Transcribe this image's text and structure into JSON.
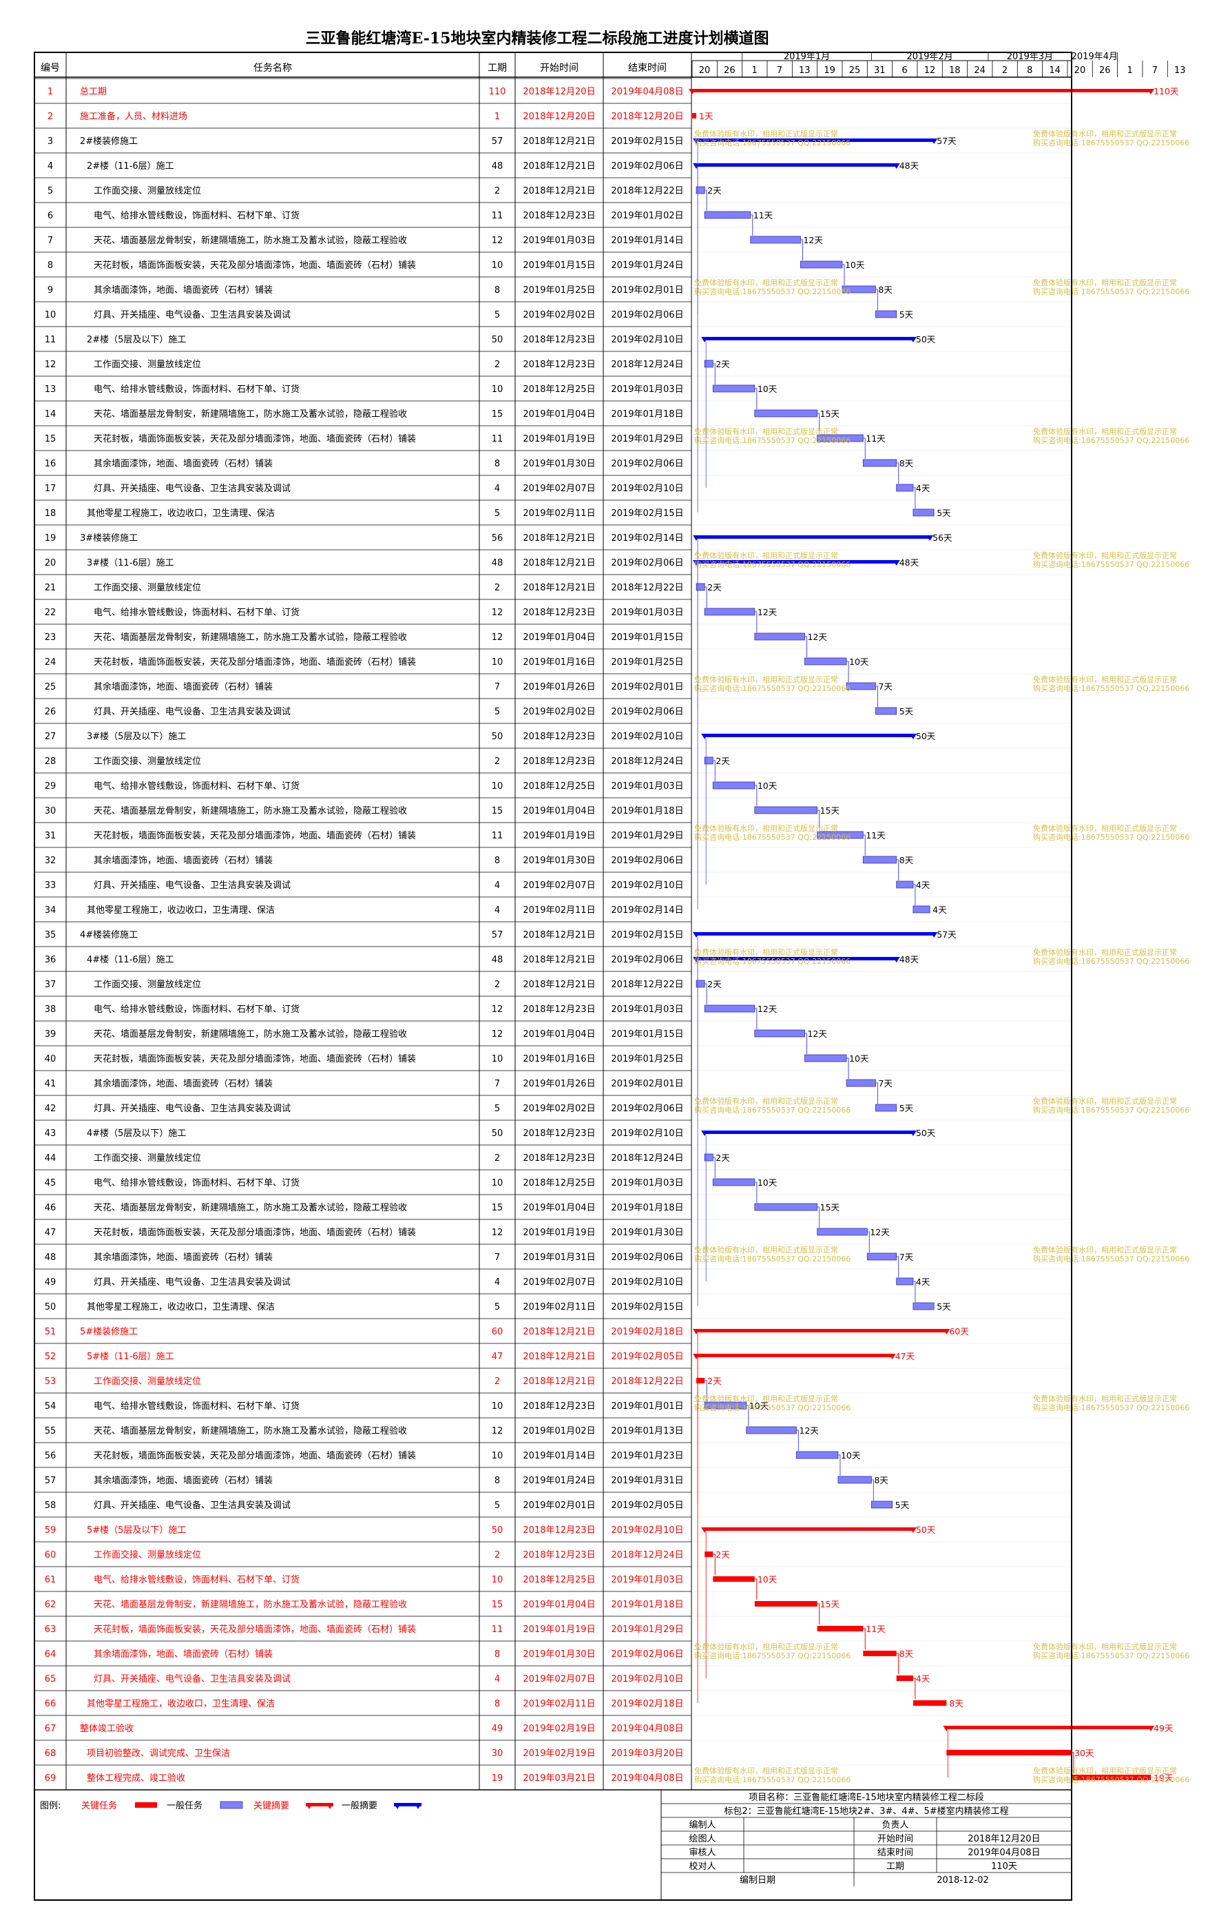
{
  "title": "三亚鲁能红塘湾E-15地块室内精装修工程二标段施工进度计划横道图",
  "table_headers": {
    "id": "编号",
    "name": "任务名称",
    "duration": "工期",
    "start": "开始时间",
    "end": "结束时间"
  },
  "timeline": {
    "months": [
      "2019年1月",
      "2019年2月",
      "2019年3月",
      "2019年4月"
    ],
    "ticks": [
      "20",
      "26",
      "1",
      "7",
      "13",
      "19",
      "25",
      "31",
      "6",
      "12",
      "18",
      "24",
      "2",
      "8",
      "14",
      "20",
      "26",
      "1",
      "7",
      "13"
    ]
  },
  "chart_data": {
    "type": "gantt",
    "x_range": [
      "2018-12-20",
      "2019-04-16"
    ],
    "tasks": [
      {
        "id": "1",
        "name": "总工期",
        "duration": "110",
        "start": "2018年12月20日",
        "end": "2019年04月08日",
        "kind": "key-summary",
        "critical": true,
        "level": 0,
        "label": "110天"
      },
      {
        "id": "2",
        "name": "施工准备，人员、材料进场",
        "duration": "1",
        "start": "2018年12月20日",
        "end": "2018年12月20日",
        "kind": "key-task",
        "critical": true,
        "level": 0,
        "label": "1天"
      },
      {
        "id": "3",
        "name": "2#楼装修施工",
        "duration": "57",
        "start": "2018年12月21日",
        "end": "2019年02月15日",
        "kind": "summary",
        "critical": false,
        "level": 0,
        "label": "57天"
      },
      {
        "id": "4",
        "name": "2#楼（11-6层）施工",
        "duration": "48",
        "start": "2018年12月21日",
        "end": "2019年02月06日",
        "kind": "summary",
        "critical": false,
        "level": 1,
        "label": "48天"
      },
      {
        "id": "5",
        "name": "工作面交接、测量放线定位",
        "duration": "2",
        "start": "2018年12月21日",
        "end": "2018年12月22日",
        "kind": "task",
        "critical": false,
        "level": 2,
        "label": "2天"
      },
      {
        "id": "6",
        "name": "电气、给排水管线敷设，饰面材料、石材下单、订货",
        "duration": "11",
        "start": "2018年12月23日",
        "end": "2019年01月02日",
        "kind": "task",
        "critical": false,
        "level": 2,
        "label": "11天"
      },
      {
        "id": "7",
        "name": "天花、墙面基层龙骨制安，新建隔墙施工，防水施工及蓄水试验，隐蔽工程验收",
        "duration": "12",
        "start": "2019年01月03日",
        "end": "2019年01月14日",
        "kind": "task",
        "critical": false,
        "level": 2,
        "label": "12天"
      },
      {
        "id": "8",
        "name": "天花封板，墙面饰面板安装，天花及部分墙面漆饰，地面、墙面瓷砖（石材）铺装",
        "duration": "10",
        "start": "2019年01月15日",
        "end": "2019年01月24日",
        "kind": "task",
        "critical": false,
        "level": 2,
        "label": "10天"
      },
      {
        "id": "9",
        "name": "其余墙面漆饰，地面、墙面瓷砖（石材）铺装",
        "duration": "8",
        "start": "2019年01月25日",
        "end": "2019年02月01日",
        "kind": "task",
        "critical": false,
        "level": 2,
        "label": "8天"
      },
      {
        "id": "10",
        "name": "灯具、开关插座、电气设备、卫生洁具安装及调试",
        "duration": "5",
        "start": "2019年02月02日",
        "end": "2019年02月06日",
        "kind": "task",
        "critical": false,
        "level": 2,
        "label": "5天"
      },
      {
        "id": "11",
        "name": "2#楼（5层及以下）施工",
        "duration": "50",
        "start": "2018年12月23日",
        "end": "2019年02月10日",
        "kind": "summary",
        "critical": false,
        "level": 1,
        "label": "50天"
      },
      {
        "id": "12",
        "name": "工作面交接、测量放线定位",
        "duration": "2",
        "start": "2018年12月23日",
        "end": "2018年12月24日",
        "kind": "task",
        "critical": false,
        "level": 2,
        "label": "2天"
      },
      {
        "id": "13",
        "name": "电气、给排水管线敷设，饰面材料、石材下单、订货",
        "duration": "10",
        "start": "2018年12月25日",
        "end": "2019年01月03日",
        "kind": "task",
        "critical": false,
        "level": 2,
        "label": "10天"
      },
      {
        "id": "14",
        "name": "天花、墙面基层龙骨制安，新建隔墙施工，防水施工及蓄水试验，隐蔽工程验收",
        "duration": "15",
        "start": "2019年01月04日",
        "end": "2019年01月18日",
        "kind": "task",
        "critical": false,
        "level": 2,
        "label": "15天"
      },
      {
        "id": "15",
        "name": "天花封板，墙面饰面板安装，天花及部分墙面漆饰，地面、墙面瓷砖（石材）铺装",
        "duration": "11",
        "start": "2019年01月19日",
        "end": "2019年01月29日",
        "kind": "task",
        "critical": false,
        "level": 2,
        "label": "11天"
      },
      {
        "id": "16",
        "name": "其余墙面漆饰，地面、墙面瓷砖（石材）铺装",
        "duration": "8",
        "start": "2019年01月30日",
        "end": "2019年02月06日",
        "kind": "task",
        "critical": false,
        "level": 2,
        "label": "8天"
      },
      {
        "id": "17",
        "name": "灯具、开关插座、电气设备、卫生洁具安装及调试",
        "duration": "4",
        "start": "2019年02月07日",
        "end": "2019年02月10日",
        "kind": "task",
        "critical": false,
        "level": 2,
        "label": "4天"
      },
      {
        "id": "18",
        "name": "其他零星工程施工，收边收口，卫生清理、保洁",
        "duration": "5",
        "start": "2019年02月11日",
        "end": "2019年02月15日",
        "kind": "task",
        "critical": false,
        "level": 1,
        "label": "5天"
      },
      {
        "id": "19",
        "name": "3#楼装修施工",
        "duration": "56",
        "start": "2018年12月21日",
        "end": "2019年02月14日",
        "kind": "summary",
        "critical": false,
        "level": 0,
        "label": "56天"
      },
      {
        "id": "20",
        "name": "3#楼（11-6层）施工",
        "duration": "48",
        "start": "2018年12月21日",
        "end": "2019年02月06日",
        "kind": "summary",
        "critical": false,
        "level": 1,
        "label": "48天"
      },
      {
        "id": "21",
        "name": "工作面交接、测量放线定位",
        "duration": "2",
        "start": "2018年12月21日",
        "end": "2018年12月22日",
        "kind": "task",
        "critical": false,
        "level": 2,
        "label": "2天"
      },
      {
        "id": "22",
        "name": "电气、给排水管线敷设，饰面材料、石材下单、订货",
        "duration": "12",
        "start": "2018年12月23日",
        "end": "2019年01月03日",
        "kind": "task",
        "critical": false,
        "level": 2,
        "label": "12天"
      },
      {
        "id": "23",
        "name": "天花、墙面基层龙骨制安，新建隔墙施工，防水施工及蓄水试验，隐蔽工程验收",
        "duration": "12",
        "start": "2019年01月04日",
        "end": "2019年01月15日",
        "kind": "task",
        "critical": false,
        "level": 2,
        "label": "12天"
      },
      {
        "id": "24",
        "name": "天花封板，墙面饰面板安装，天花及部分墙面漆饰，地面、墙面瓷砖（石材）铺装",
        "duration": "10",
        "start": "2019年01月16日",
        "end": "2019年01月25日",
        "kind": "task",
        "critical": false,
        "level": 2,
        "label": "10天"
      },
      {
        "id": "25",
        "name": "其余墙面漆饰，地面、墙面瓷砖（石材）铺装",
        "duration": "7",
        "start": "2019年01月26日",
        "end": "2019年02月01日",
        "kind": "task",
        "critical": false,
        "level": 2,
        "label": "7天"
      },
      {
        "id": "26",
        "name": "灯具、开关插座、电气设备、卫生洁具安装及调试",
        "duration": "5",
        "start": "2019年02月02日",
        "end": "2019年02月06日",
        "kind": "task",
        "critical": false,
        "level": 2,
        "label": "5天"
      },
      {
        "id": "27",
        "name": "3#楼（5层及以下）施工",
        "duration": "50",
        "start": "2018年12月23日",
        "end": "2019年02月10日",
        "kind": "summary",
        "critical": false,
        "level": 1,
        "label": "50天"
      },
      {
        "id": "28",
        "name": "工作面交接、测量放线定位",
        "duration": "2",
        "start": "2018年12月23日",
        "end": "2018年12月24日",
        "kind": "task",
        "critical": false,
        "level": 2,
        "label": "2天"
      },
      {
        "id": "29",
        "name": "电气、给排水管线敷设，饰面材料、石材下单、订货",
        "duration": "10",
        "start": "2018年12月25日",
        "end": "2019年01月03日",
        "kind": "task",
        "critical": false,
        "level": 2,
        "label": "10天"
      },
      {
        "id": "30",
        "name": "天花、墙面基层龙骨制安，新建隔墙施工，防水施工及蓄水试验，隐蔽工程验收",
        "duration": "15",
        "start": "2019年01月04日",
        "end": "2019年01月18日",
        "kind": "task",
        "critical": false,
        "level": 2,
        "label": "15天"
      },
      {
        "id": "31",
        "name": "天花封板，墙面饰面板安装，天花及部分墙面漆饰，地面、墙面瓷砖（石材）铺装",
        "duration": "11",
        "start": "2019年01月19日",
        "end": "2019年01月29日",
        "kind": "task",
        "critical": false,
        "level": 2,
        "label": "11天"
      },
      {
        "id": "32",
        "name": "其余墙面漆饰，地面、墙面瓷砖（石材）铺装",
        "duration": "8",
        "start": "2019年01月30日",
        "end": "2019年02月06日",
        "kind": "task",
        "critical": false,
        "level": 2,
        "label": "8天"
      },
      {
        "id": "33",
        "name": "灯具、开关插座、电气设备、卫生洁具安装及调试",
        "duration": "4",
        "start": "2019年02月07日",
        "end": "2019年02月10日",
        "kind": "task",
        "critical": false,
        "level": 2,
        "label": "4天"
      },
      {
        "id": "34",
        "name": "其他零星工程施工，收边收口，卫生清理、保洁",
        "duration": "4",
        "start": "2019年02月11日",
        "end": "2019年02月14日",
        "kind": "task",
        "critical": false,
        "level": 1,
        "label": "4天"
      },
      {
        "id": "35",
        "name": "4#楼装修施工",
        "duration": "57",
        "start": "2018年12月21日",
        "end": "2019年02月15日",
        "kind": "summary",
        "critical": false,
        "level": 0,
        "label": "57天"
      },
      {
        "id": "36",
        "name": "4#楼（11-6层）施工",
        "duration": "48",
        "start": "2018年12月21日",
        "end": "2019年02月06日",
        "kind": "summary",
        "critical": false,
        "level": 1,
        "label": "48天"
      },
      {
        "id": "37",
        "name": "工作面交接、测量放线定位",
        "duration": "2",
        "start": "2018年12月21日",
        "end": "2018年12月22日",
        "kind": "task",
        "critical": false,
        "level": 2,
        "label": "2天"
      },
      {
        "id": "38",
        "name": "电气、给排水管线敷设，饰面材料、石材下单、订货",
        "duration": "12",
        "start": "2018年12月23日",
        "end": "2019年01月03日",
        "kind": "task",
        "critical": false,
        "level": 2,
        "label": "12天"
      },
      {
        "id": "39",
        "name": "天花、墙面基层龙骨制安，新建隔墙施工，防水施工及蓄水试验，隐蔽工程验收",
        "duration": "12",
        "start": "2019年01月04日",
        "end": "2019年01月15日",
        "kind": "task",
        "critical": false,
        "level": 2,
        "label": "12天"
      },
      {
        "id": "40",
        "name": "天花封板，墙面饰面板安装，天花及部分墙面漆饰，地面、墙面瓷砖（石材）铺装",
        "duration": "10",
        "start": "2019年01月16日",
        "end": "2019年01月25日",
        "kind": "task",
        "critical": false,
        "level": 2,
        "label": "10天"
      },
      {
        "id": "41",
        "name": "其余墙面漆饰，地面、墙面瓷砖（石材）铺装",
        "duration": "7",
        "start": "2019年01月26日",
        "end": "2019年02月01日",
        "kind": "task",
        "critical": false,
        "level": 2,
        "label": "7天"
      },
      {
        "id": "42",
        "name": "灯具、开关插座、电气设备、卫生洁具安装及调试",
        "duration": "5",
        "start": "2019年02月02日",
        "end": "2019年02月06日",
        "kind": "task",
        "critical": false,
        "level": 2,
        "label": "5天"
      },
      {
        "id": "43",
        "name": "4#楼（5层及以下）施工",
        "duration": "50",
        "start": "2018年12月23日",
        "end": "2019年02月10日",
        "kind": "summary",
        "critical": false,
        "level": 1,
        "label": "50天"
      },
      {
        "id": "44",
        "name": "工作面交接、测量放线定位",
        "duration": "2",
        "start": "2018年12月23日",
        "end": "2018年12月24日",
        "kind": "task",
        "critical": false,
        "level": 2,
        "label": "2天"
      },
      {
        "id": "45",
        "name": "电气、给排水管线敷设，饰面材料、石材下单、订货",
        "duration": "10",
        "start": "2018年12月25日",
        "end": "2019年01月03日",
        "kind": "task",
        "critical": false,
        "level": 2,
        "label": "10天"
      },
      {
        "id": "46",
        "name": "天花、墙面基层龙骨制安，新建隔墙施工，防水施工及蓄水试验，隐蔽工程验收",
        "duration": "15",
        "start": "2019年01月04日",
        "end": "2019年01月18日",
        "kind": "task",
        "critical": false,
        "level": 2,
        "label": "15天"
      },
      {
        "id": "47",
        "name": "天花封板，墙面饰面板安装，天花及部分墙面漆饰，地面、墙面瓷砖（石材）铺装",
        "duration": "12",
        "start": "2019年01月19日",
        "end": "2019年01月30日",
        "kind": "task",
        "critical": false,
        "level": 2,
        "label": "12天"
      },
      {
        "id": "48",
        "name": "其余墙面漆饰，地面、墙面瓷砖（石材）铺装",
        "duration": "7",
        "start": "2019年01月31日",
        "end": "2019年02月06日",
        "kind": "task",
        "critical": false,
        "level": 2,
        "label": "7天"
      },
      {
        "id": "49",
        "name": "灯具、开关插座、电气设备、卫生洁具安装及调试",
        "duration": "4",
        "start": "2019年02月07日",
        "end": "2019年02月10日",
        "kind": "task",
        "critical": false,
        "level": 2,
        "label": "4天"
      },
      {
        "id": "50",
        "name": "其他零星工程施工，收边收口，卫生清理、保洁",
        "duration": "5",
        "start": "2019年02月11日",
        "end": "2019年02月15日",
        "kind": "task",
        "critical": false,
        "level": 1,
        "label": "5天"
      },
      {
        "id": "51",
        "name": "5#楼装修施工",
        "duration": "60",
        "start": "2018年12月21日",
        "end": "2019年02月18日",
        "kind": "key-summary",
        "critical": true,
        "level": 0,
        "label": "60天"
      },
      {
        "id": "52",
        "name": "5#楼（11-6层）施工",
        "duration": "47",
        "start": "2018年12月21日",
        "end": "2019年02月05日",
        "kind": "key-summary",
        "critical": true,
        "level": 1,
        "label": "47天"
      },
      {
        "id": "53",
        "name": "工作面交接、测量放线定位",
        "duration": "2",
        "start": "2018年12月21日",
        "end": "2018年12月22日",
        "kind": "key-task",
        "critical": true,
        "level": 2,
        "label": "2天"
      },
      {
        "id": "54",
        "name": "电气、给排水管线敷设，饰面材料、石材下单、订货",
        "duration": "10",
        "start": "2018年12月23日",
        "end": "2019年01月01日",
        "kind": "task",
        "critical": false,
        "level": 2,
        "label": "10天"
      },
      {
        "id": "55",
        "name": "天花、墙面基层龙骨制安，新建隔墙施工，防水施工及蓄水试验，隐蔽工程验收",
        "duration": "12",
        "start": "2019年01月02日",
        "end": "2019年01月13日",
        "kind": "task",
        "critical": false,
        "level": 2,
        "label": "12天"
      },
      {
        "id": "56",
        "name": "天花封板，墙面饰面板安装，天花及部分墙面漆饰，地面、墙面瓷砖（石材）铺装",
        "duration": "10",
        "start": "2019年01月14日",
        "end": "2019年01月23日",
        "kind": "task",
        "critical": false,
        "level": 2,
        "label": "10天"
      },
      {
        "id": "57",
        "name": "其余墙面漆饰，地面、墙面瓷砖（石材）铺装",
        "duration": "8",
        "start": "2019年01月24日",
        "end": "2019年01月31日",
        "kind": "task",
        "critical": false,
        "level": 2,
        "label": "8天"
      },
      {
        "id": "58",
        "name": "灯具、开关插座、电气设备、卫生洁具安装及调试",
        "duration": "5",
        "start": "2019年02月01日",
        "end": "2019年02月05日",
        "kind": "task",
        "critical": false,
        "level": 2,
        "label": "5天"
      },
      {
        "id": "59",
        "name": "5#楼（5层及以下）施工",
        "duration": "50",
        "start": "2018年12月23日",
        "end": "2019年02月10日",
        "kind": "key-summary",
        "critical": true,
        "level": 1,
        "label": "50天"
      },
      {
        "id": "60",
        "name": "工作面交接、测量放线定位",
        "duration": "2",
        "start": "2018年12月23日",
        "end": "2018年12月24日",
        "kind": "key-task",
        "critical": true,
        "level": 2,
        "label": "2天"
      },
      {
        "id": "61",
        "name": "电气、给排水管线敷设，饰面材料、石材下单、订货",
        "duration": "10",
        "start": "2018年12月25日",
        "end": "2019年01月03日",
        "kind": "key-task",
        "critical": true,
        "level": 2,
        "label": "10天"
      },
      {
        "id": "62",
        "name": "天花、墙面基层龙骨制安，新建隔墙施工，防水施工及蓄水试验，隐蔽工程验收",
        "duration": "15",
        "start": "2019年01月04日",
        "end": "2019年01月18日",
        "kind": "key-task",
        "critical": true,
        "level": 2,
        "label": "15天"
      },
      {
        "id": "63",
        "name": "天花封板，墙面饰面板安装，天花及部分墙面漆饰，地面、墙面瓷砖（石材）铺装",
        "duration": "11",
        "start": "2019年01月19日",
        "end": "2019年01月29日",
        "kind": "key-task",
        "critical": true,
        "level": 2,
        "label": "11天"
      },
      {
        "id": "64",
        "name": "其余墙面漆饰，地面、墙面瓷砖（石材）铺装",
        "duration": "8",
        "start": "2019年01月30日",
        "end": "2019年02月06日",
        "kind": "key-task",
        "critical": true,
        "level": 2,
        "label": "8天"
      },
      {
        "id": "65",
        "name": "灯具、开关插座、电气设备、卫生洁具安装及调试",
        "duration": "4",
        "start": "2019年02月07日",
        "end": "2019年02月10日",
        "kind": "key-task",
        "critical": true,
        "level": 2,
        "label": "4天"
      },
      {
        "id": "66",
        "name": "其他零星工程施工，收边收口，卫生清理、保洁",
        "duration": "8",
        "start": "2019年02月11日",
        "end": "2019年02月18日",
        "kind": "key-task",
        "critical": true,
        "level": 1,
        "label": "8天"
      },
      {
        "id": "67",
        "name": "整体竣工验收",
        "duration": "49",
        "start": "2019年02月19日",
        "end": "2019年04月08日",
        "kind": "key-summary",
        "critical": true,
        "level": 0,
        "label": "49天"
      },
      {
        "id": "68",
        "name": "项目初验整改、调试完成、卫生保洁",
        "duration": "30",
        "start": "2019年02月19日",
        "end": "2019年03月20日",
        "kind": "key-task",
        "critical": true,
        "level": 1,
        "label": "30天"
      },
      {
        "id": "69",
        "name": "整体工程完成、竣工验收",
        "duration": "19",
        "start": "2019年03月21日",
        "end": "2019年04月08日",
        "kind": "key-task",
        "critical": true,
        "level": 1,
        "label": "19天"
      }
    ]
  },
  "legend": {
    "prefix": "图例:",
    "key_task": "关键任务",
    "task": "一般任务",
    "key_summary": "关键摘要",
    "summary": "一般摘要"
  },
  "info_box": {
    "project_line1": "项目名称：三亚鲁能红塘湾E-15地块室内精装修工程二标段",
    "project_line2": "标包2：三亚鲁能红塘湾E-15地块2#、3#、4#、5#楼室内精装修工程",
    "rows": [
      {
        "l1": "编制人",
        "v1": "",
        "l2": "负责人",
        "v2": ""
      },
      {
        "l1": "绘图人",
        "v1": "",
        "l2": "开始时间",
        "v2": "2018年12月20日"
      },
      {
        "l1": "审核人",
        "v1": "",
        "l2": "结束时间",
        "v2": "2019年04月08日"
      },
      {
        "l1": "校对人",
        "v1": "",
        "l2": "工期",
        "v2": "110天"
      }
    ],
    "date_label": "编制日期",
    "date_value": "2018-12-02"
  },
  "watermark": {
    "line1": "免费体验版有水印，相用和正式版显示正常",
    "line2": "购买咨询电话:18675550537 QQ:22150066"
  },
  "colors": {
    "critical": "#ff0000",
    "task_fill": "#8080ff",
    "task_stroke": "#3333aa",
    "summary": "#0000ff",
    "link": "#4a4aff",
    "watermark": "#d4c04a"
  }
}
